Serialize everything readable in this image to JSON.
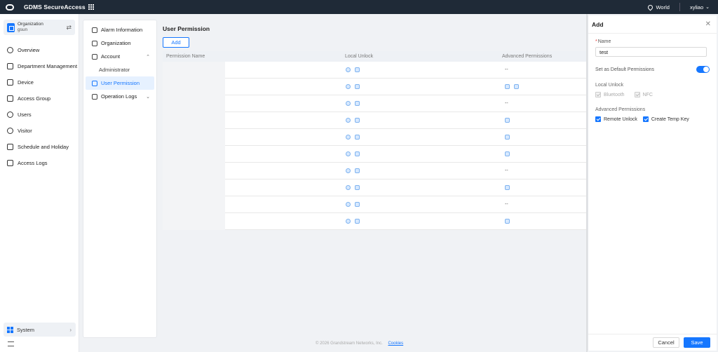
{
  "topbar": {
    "brand": "GDMS SecureAccess",
    "region": "World",
    "user": "xyliao"
  },
  "org": {
    "label": "Organization",
    "name": "gsun"
  },
  "nav": [
    {
      "label": "Overview",
      "icon": "overview-icon"
    },
    {
      "label": "Department Management",
      "icon": "department-icon"
    },
    {
      "label": "Device",
      "icon": "device-icon"
    },
    {
      "label": "Access Group",
      "icon": "access-group-icon"
    },
    {
      "label": "Users",
      "icon": "users-icon"
    },
    {
      "label": "Visitor",
      "icon": "visitor-icon"
    },
    {
      "label": "Schedule and Holiday",
      "icon": "calendar-icon"
    },
    {
      "label": "Access Logs",
      "icon": "logs-icon"
    }
  ],
  "system": {
    "label": "System"
  },
  "submenu": {
    "alarm": "Alarm Information",
    "organization": "Organization",
    "account": "Account",
    "administrator": "Administrator",
    "user_permission": "User Permission",
    "operation_logs": "Operation Logs"
  },
  "page": {
    "title": "User Permission",
    "add_label": "Add"
  },
  "table": {
    "columns": [
      "Permission Name",
      "Local Unlock",
      "Advanced Permissions"
    ],
    "rows": [
      {
        "adv": "--"
      },
      {
        "adv_icons": [
          "phone",
          "key"
        ]
      },
      {
        "adv": "--"
      },
      {
        "adv_icons": [
          "key"
        ]
      },
      {
        "adv_icons": [
          "phone"
        ]
      },
      {
        "adv_icons": [
          "key"
        ]
      },
      {
        "adv": "--"
      },
      {
        "adv_icons": [
          "key"
        ]
      },
      {
        "adv": "--"
      },
      {
        "adv_icons": [
          "phone"
        ]
      }
    ]
  },
  "footer": {
    "copyright": "© 2026 Grandstream Networks, Inc.",
    "cookies": "Cookies"
  },
  "drawer": {
    "title": "Add",
    "name_label": "Name",
    "name_value": "test",
    "default_label": "Set as Default Permissions",
    "default_on": true,
    "local_unlock_label": "Local Unlock",
    "bluetooth_label": "Bluetooth",
    "nfc_label": "NFC",
    "advanced_label": "Advanced Permissions",
    "remote_unlock_label": "Remote Unlock",
    "temp_key_label": "Create Temp Key",
    "cancel_label": "Cancel",
    "save_label": "Save"
  },
  "colors": {
    "accent": "#1677ff",
    "topbar": "#1f2a37"
  }
}
